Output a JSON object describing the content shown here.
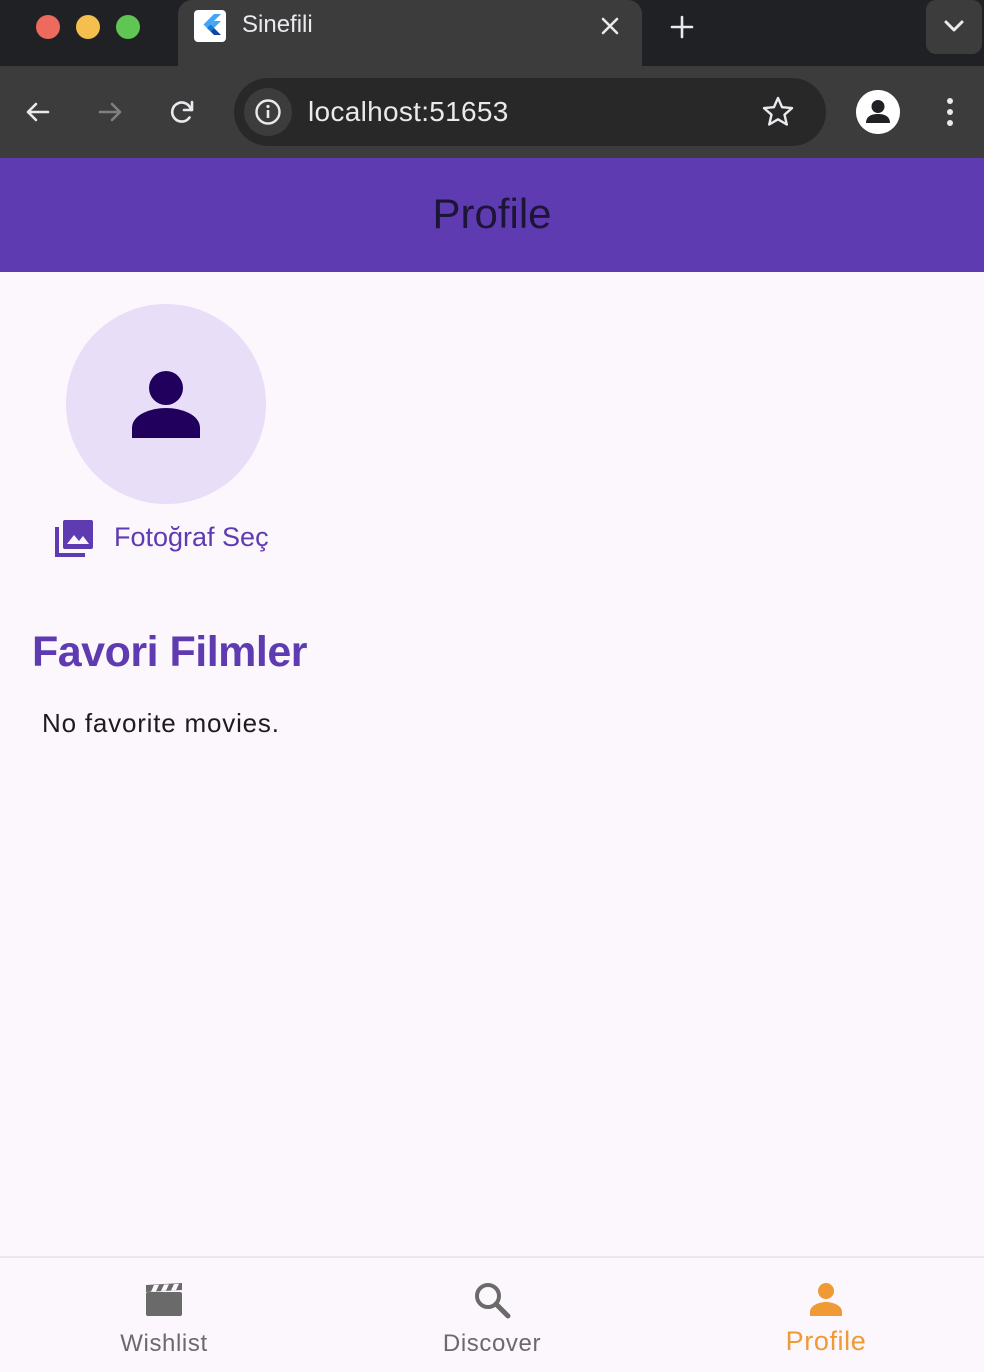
{
  "browser": {
    "tab_title": "Sinefili",
    "url": "localhost:51653"
  },
  "appbar": {
    "title": "Profile",
    "color": "#5e3bb0"
  },
  "profile": {
    "pick_photo_label": "Fotoğraf Seç",
    "favorites_title": "Favori Filmler",
    "favorites_empty": "No favorite movies."
  },
  "bottom_nav": {
    "items": [
      {
        "label": "Wishlist",
        "icon": "movie-icon",
        "active": false
      },
      {
        "label": "Discover",
        "icon": "search-icon",
        "active": false
      },
      {
        "label": "Profile",
        "icon": "person-icon",
        "active": true
      }
    ],
    "active_color": "#ef9a35",
    "inactive_color": "#6a6a6a"
  }
}
